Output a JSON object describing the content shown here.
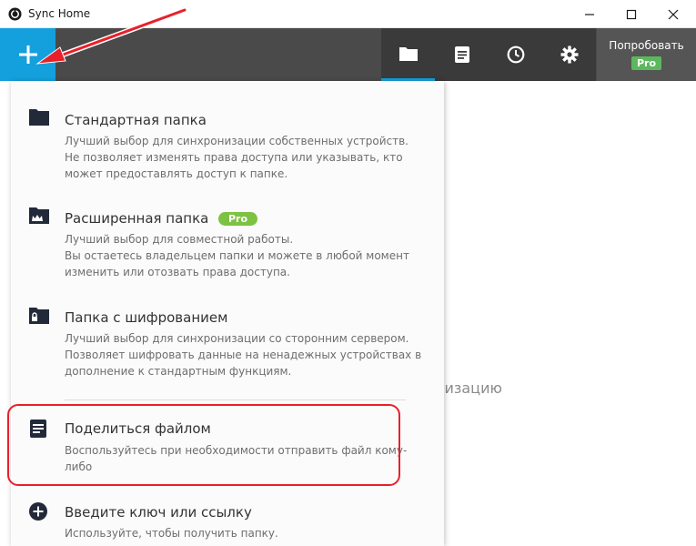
{
  "window": {
    "title": "Sync Home",
    "icons": [
      "app-logo-icon",
      "minimize-icon",
      "maximize-icon",
      "close-icon"
    ]
  },
  "toolbar": {
    "add_icon": "plus-icon",
    "tabs": [
      {
        "icon": "folder-icon",
        "active": true
      },
      {
        "icon": "notes-icon",
        "active": false
      },
      {
        "icon": "clock-icon",
        "active": false
      },
      {
        "icon": "gear-icon",
        "active": false
      }
    ],
    "try_pro": {
      "label": "Попробовать",
      "badge": "Pro"
    },
    "colors": {
      "accent": "#14a0dc",
      "bar": "#4a4a4a",
      "pro": "#5cb85c"
    }
  },
  "background": {
    "partial_text": "низацию"
  },
  "menu": {
    "items": [
      {
        "icon": "folder-icon",
        "title": "Стандартная папка",
        "desc": [
          "Лучший выбор для синхронизации собственных устройств.",
          "Не позволяет изменять права доступа или указывать, кто",
          "может предоставлять доступ к папке."
        ]
      },
      {
        "icon": "crown-folder-icon",
        "title": "Расширенная папка",
        "badge": "Pro",
        "desc": [
          "Лучший выбор для совместной работы.",
          "Вы остаетесь владельцем папки и можете в любой момент",
          "изменить или отозвать права доступа."
        ]
      },
      {
        "icon": "lock-folder-icon",
        "title": "Папка с шифрованием",
        "desc": [
          "Лучший выбор для синхронизации со сторонним сервером.",
          "Позволяет шифровать данные на ненадежных устройствах в",
          "дополнение к стандартным функциям."
        ]
      },
      {
        "icon": "document-icon",
        "title": "Поделиться файлом",
        "desc": [
          "Воспользуйтесь при необходимости отправить файл кому-",
          "либо"
        ]
      },
      {
        "icon": "plus-circle-icon",
        "title": "Введите ключ или ссылку",
        "desc": [
          "Используйте, чтобы получить папку."
        ]
      }
    ]
  },
  "annotation": {
    "color": "#e8202a"
  }
}
